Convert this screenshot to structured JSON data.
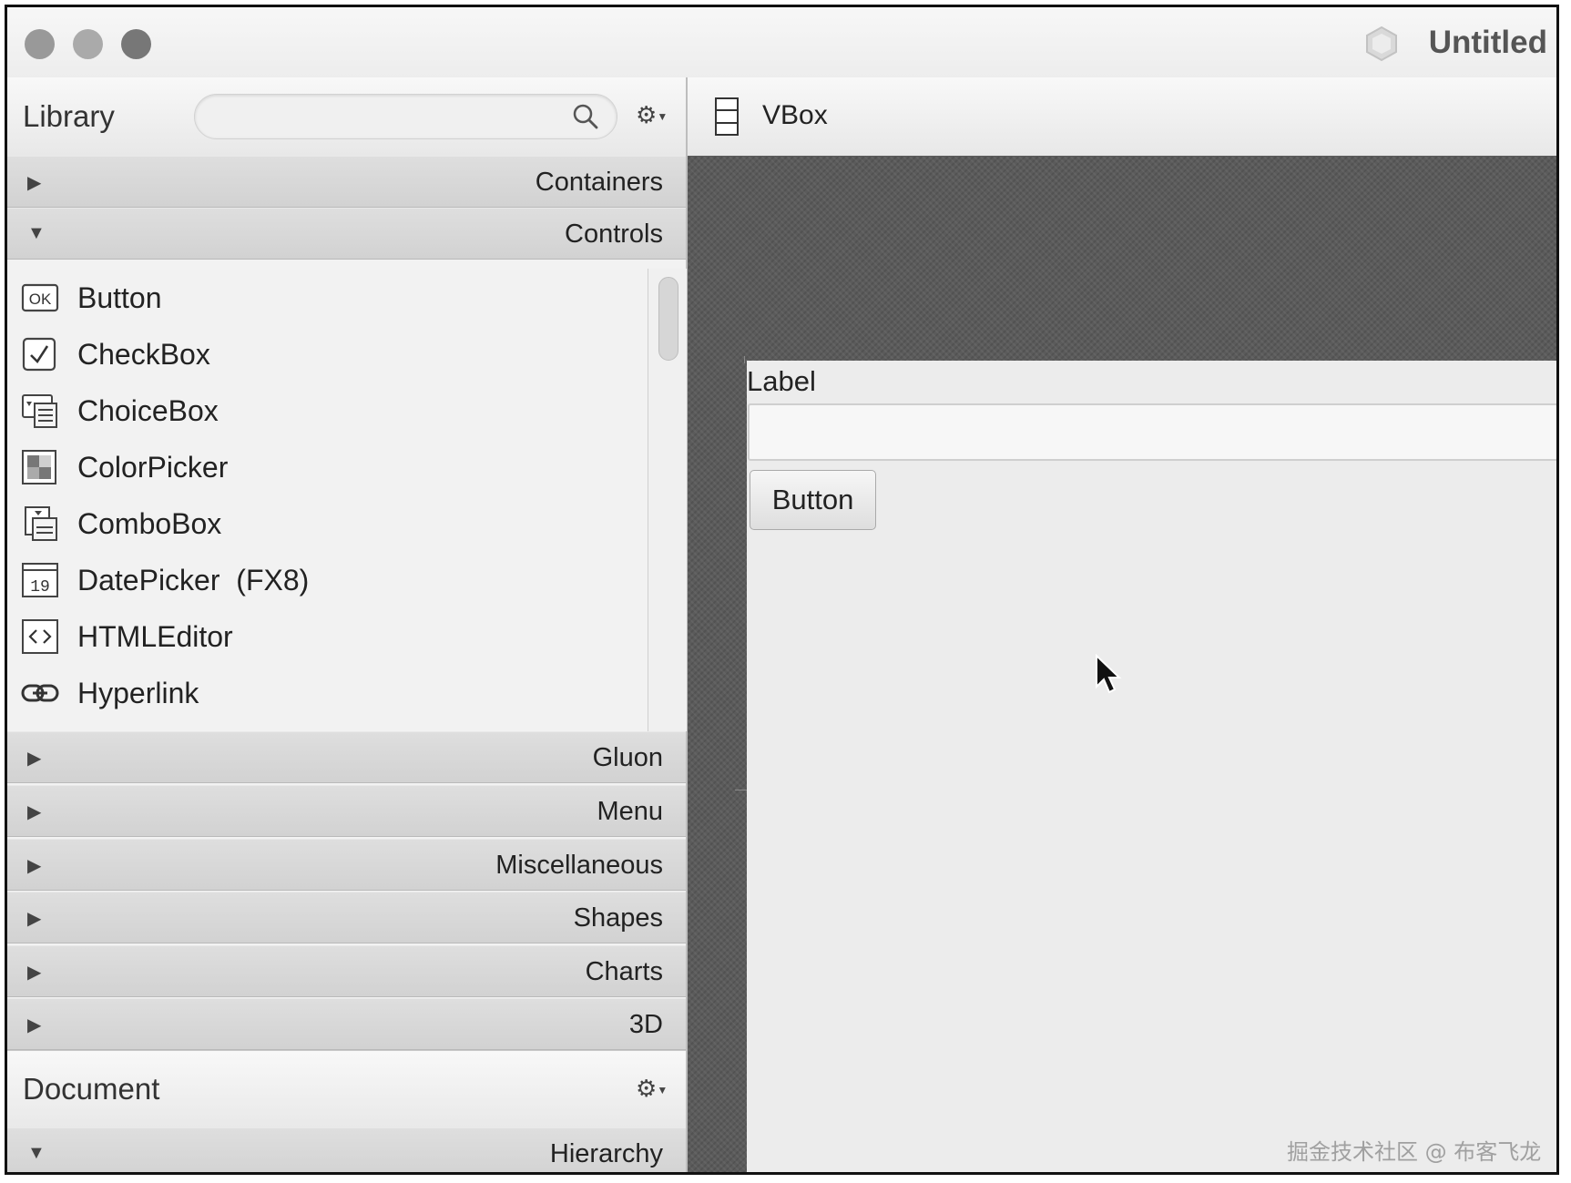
{
  "window": {
    "title": "Untitled",
    "logo_icon": "scene-builder-logo-icon"
  },
  "library": {
    "title": "Library",
    "search": {
      "value": "",
      "placeholder": ""
    },
    "sections_top": [
      {
        "label": "Containers",
        "expanded": false
      },
      {
        "label": "Controls",
        "expanded": true
      }
    ],
    "controls": [
      {
        "label": "Button",
        "icon": "button-ok-icon"
      },
      {
        "label": "CheckBox",
        "icon": "checkbox-icon"
      },
      {
        "label": "ChoiceBox",
        "icon": "choicebox-icon"
      },
      {
        "label": "ColorPicker",
        "icon": "colorpicker-icon"
      },
      {
        "label": "ComboBox",
        "icon": "combobox-icon"
      },
      {
        "label": "DatePicker  (FX8)",
        "icon": "datepicker-icon"
      },
      {
        "label": "HTMLEditor",
        "icon": "htmleditor-icon"
      },
      {
        "label": "Hyperlink",
        "icon": "hyperlink-icon"
      }
    ],
    "sections_bottom": [
      {
        "label": "Gluon",
        "expanded": false
      },
      {
        "label": "Menu",
        "expanded": false
      },
      {
        "label": "Miscellaneous",
        "expanded": false
      },
      {
        "label": "Shapes",
        "expanded": false
      },
      {
        "label": "Charts",
        "expanded": false
      },
      {
        "label": "3D",
        "expanded": false
      }
    ],
    "ok_text": "OK",
    "date_text": "19"
  },
  "document": {
    "title": "Document",
    "hierarchy_label": "Hierarchy"
  },
  "breadcrumb": {
    "label": "VBox"
  },
  "stage": {
    "label_text": "Label",
    "field_value": "",
    "button_text": "Button"
  },
  "watermark": "掘金技术社区 @ 布客飞龙",
  "colors": {
    "canvas": "#5b5b5b",
    "stage": "#ececec",
    "section": "#d6d6d6"
  }
}
